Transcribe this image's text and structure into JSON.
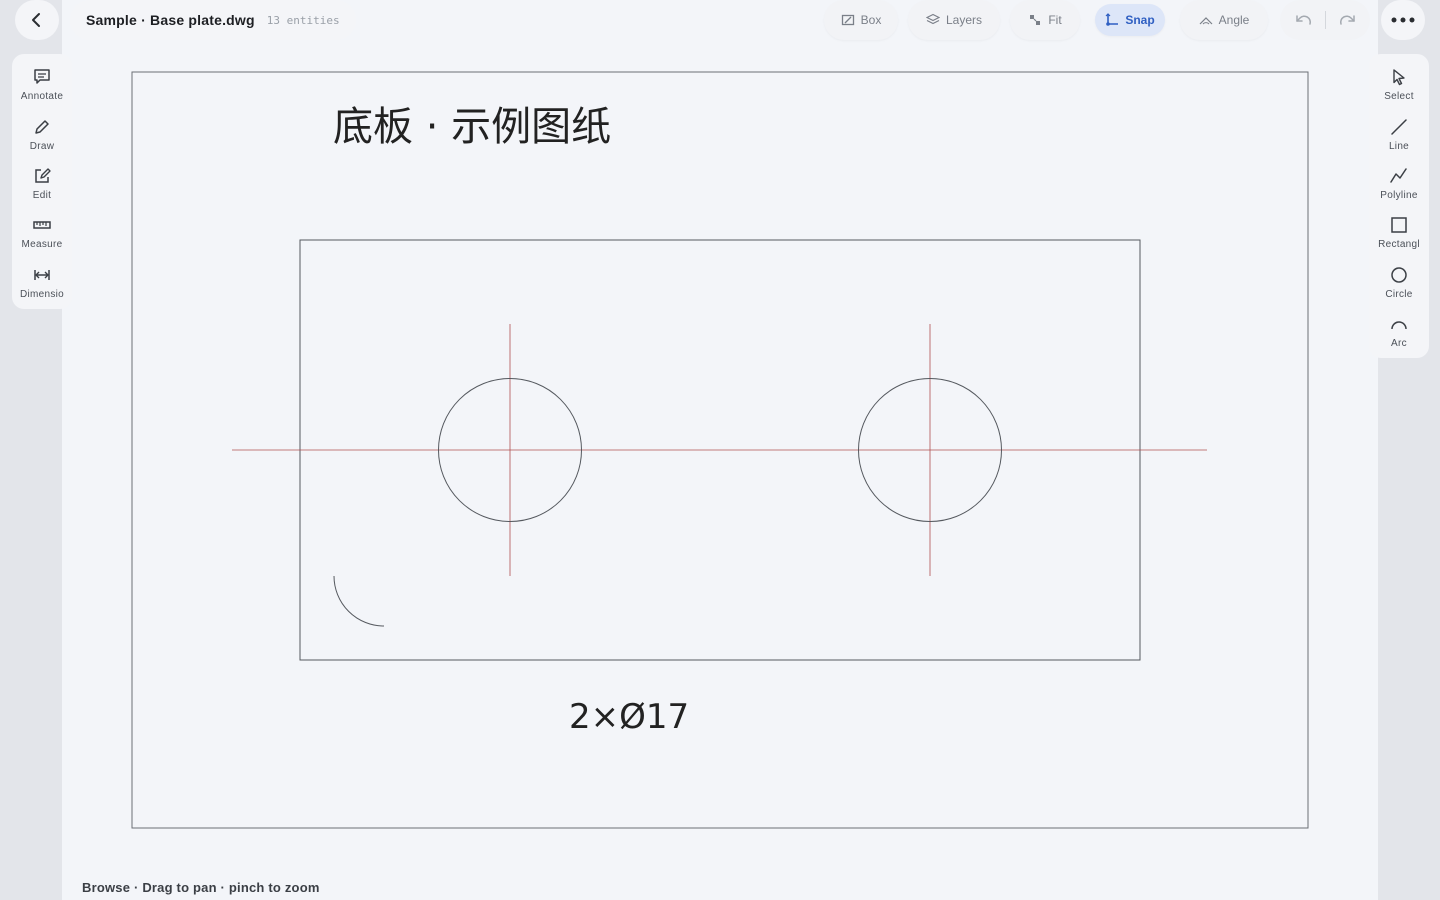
{
  "file": {
    "name": "Sample · Base plate.dwg",
    "entity_count": "13 entities"
  },
  "top_toolbar": {
    "box": "Box",
    "layers": "Layers",
    "fit": "Fit",
    "snap": "Snap",
    "angle": "Angle"
  },
  "left_tools": [
    {
      "label": "Annotate",
      "icon": "comment-icon"
    },
    {
      "label": "Draw",
      "icon": "pencil-icon"
    },
    {
      "label": "Edit",
      "icon": "edit-icon"
    },
    {
      "label": "Measure",
      "icon": "ruler-icon"
    },
    {
      "label": "Dimensio",
      "icon": "dimension-icon"
    }
  ],
  "right_tools": [
    {
      "label": "Select",
      "icon": "cursor-icon"
    },
    {
      "label": "Line",
      "icon": "line-icon"
    },
    {
      "label": "Polyline",
      "icon": "polyline-icon"
    },
    {
      "label": "Rectangl",
      "icon": "rectangle-icon"
    },
    {
      "label": "Circle",
      "icon": "circle-icon"
    },
    {
      "label": "Arc",
      "icon": "arc-icon"
    }
  ],
  "drawing": {
    "title": "底板 · 示例图纸",
    "hole_note": "2×Ø17"
  },
  "status_bar": {
    "hint": "Browse · Drag to pan · pinch to zoom"
  },
  "colors": {
    "accent": "#2f5fc2",
    "centerline": "#c24a4a",
    "geometry": "#55595f"
  }
}
